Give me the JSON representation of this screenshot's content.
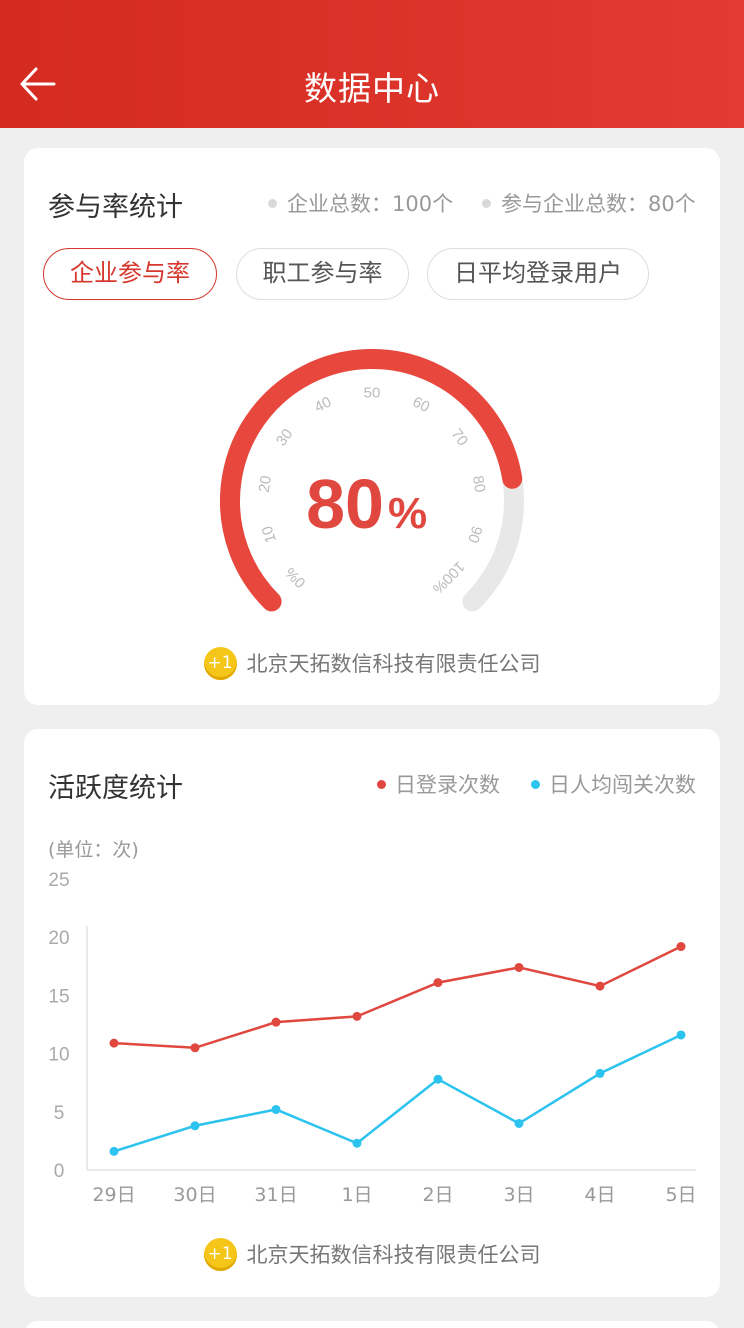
{
  "header": {
    "title": "数据中心",
    "back_icon": "arrow-left-icon",
    "bg_color": "#d42a20"
  },
  "participation": {
    "title": "参与率统计",
    "stats": [
      {
        "label": "企业总数：100个"
      },
      {
        "label": "参与企业总数：80个"
      }
    ],
    "tabs": [
      {
        "label": "企业参与率",
        "active": true
      },
      {
        "label": "职工参与率",
        "active": false
      },
      {
        "label": "日平均登录用户",
        "active": false
      }
    ],
    "gauge": {
      "value": 80,
      "value_number": "80",
      "value_unit": "%",
      "ticks": [
        "0%",
        "10",
        "20",
        "30",
        "40",
        "50",
        "60",
        "70",
        "80",
        "90",
        "100%"
      ],
      "fill_color": "#e8473d",
      "track_color": "#e8e8e8"
    },
    "footer": "北京天拓数信科技有限责任公司"
  },
  "activity": {
    "title": "活跃度统计",
    "unit": "(单位：次)",
    "footer": "北京天拓数信科技有限责任公司"
  },
  "chart_data": {
    "type": "line",
    "x": [
      "29日",
      "30日",
      "31日",
      "1日",
      "2日",
      "3日",
      "4日",
      "5日"
    ],
    "ylim": [
      0,
      25
    ],
    "yticks": [
      "0",
      "5",
      "10",
      "15",
      "20",
      "25"
    ],
    "series": [
      {
        "name": "日登录次数",
        "color": "#e0473f",
        "values": [
          10.9,
          10.5,
          12.7,
          13.2,
          16.1,
          17.4,
          15.8,
          19.2
        ]
      },
      {
        "name": "日人均闯关次数",
        "color": "#2cc3ee",
        "values": [
          1.6,
          3.8,
          5.2,
          2.3,
          7.8,
          4.0,
          8.3,
          11.6
        ]
      }
    ],
    "grid": false,
    "legend": "top-right"
  }
}
